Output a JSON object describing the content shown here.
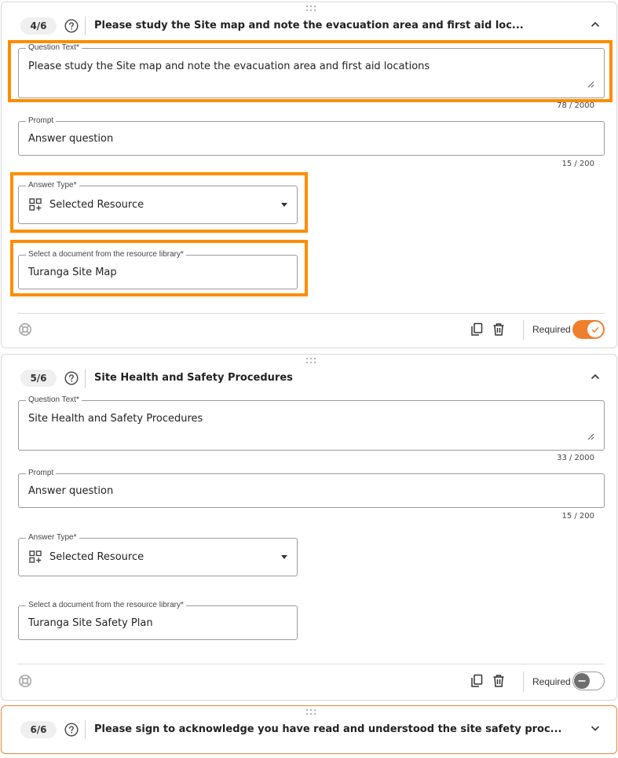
{
  "questions": [
    {
      "number": "4/6",
      "title": "Please study the Site map and note the evacuation area and first aid loc...",
      "question_text_label": "Question Text*",
      "question_text": "Please study the Site map and note the evacuation area and first aid locations",
      "question_text_counter": "78 / 2000",
      "prompt_label": "Prompt",
      "prompt": "Answer question",
      "prompt_counter": "15 / 200",
      "answer_type_label": "Answer Type*",
      "answer_type": "Selected Resource",
      "document_label": "Select a document from the resource library*",
      "document": "Turanga Site Map",
      "required_label": "Required",
      "required": true,
      "expanded": true
    },
    {
      "number": "5/6",
      "title": "Site Health and Safety Procedures",
      "question_text_label": "Question Text*",
      "question_text": "Site Health and Safety Procedures",
      "question_text_counter": "33 / 2000",
      "prompt_label": "Prompt",
      "prompt": "Answer question",
      "prompt_counter": "15 / 200",
      "answer_type_label": "Answer Type*",
      "answer_type": "Selected Resource",
      "document_label": "Select a document from the resource library*",
      "document": "Turanga Site Safety Plan",
      "required_label": "Required",
      "required": false,
      "expanded": true
    },
    {
      "number": "6/6",
      "title": "Please sign to acknowledge you have read and understood the site safety proc...",
      "expanded": false
    }
  ],
  "colors": {
    "accent": "#f07f2d",
    "highlight": "#ff8c00",
    "active_border": "#e8873a"
  },
  "icons": {
    "help": "help-circle-icon",
    "collapse": "chevron-up-icon",
    "expand": "chevron-down-icon",
    "answer_type": "grid-add-icon",
    "settings": "lifebuoy-icon",
    "duplicate": "copy-icon",
    "delete": "trash-icon",
    "drag": "drag-handle-icon"
  }
}
